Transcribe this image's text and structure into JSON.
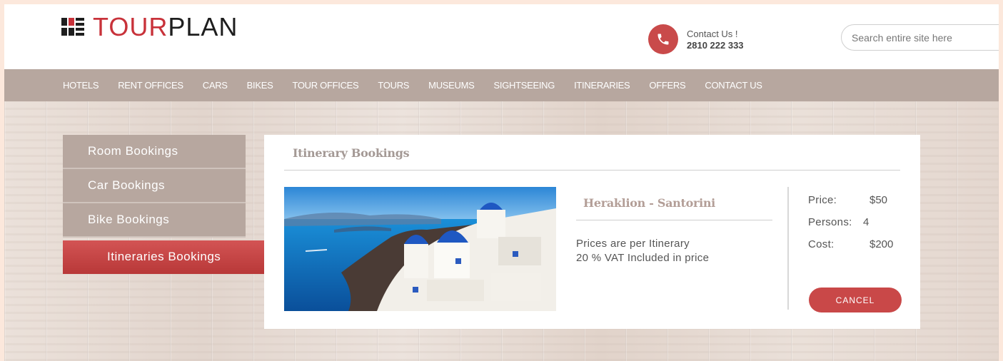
{
  "logo": {
    "part1": "TOUR",
    "part2": "PLAN"
  },
  "contact": {
    "label": "Contact Us !",
    "number": "2810 222 333"
  },
  "search": {
    "placeholder": "Search entire site here"
  },
  "nav": [
    "HOTELS",
    "RENT OFFICES",
    "CARS",
    "BIKES",
    "TOUR OFFICES",
    "TOURS",
    "MUSEUMS",
    "SIGHTSEEING",
    "ITINERARIES",
    "OFFERS",
    "CONTACT US"
  ],
  "side_menu": {
    "items": [
      "Room Bookings",
      "Car Bookings",
      "Bike Bookings"
    ],
    "active": "Itineraries Bookings"
  },
  "booking": {
    "section_title": "Itinerary Bookings",
    "trip_title": "Heraklion - Santorini",
    "note_line1": "Prices are per Itinerary",
    "note_line2": "20 % VAT Included in price",
    "price_label": "Price:",
    "price_value": "$50",
    "persons_label": "Persons:",
    "persons_value": "4",
    "cost_label": "Cost:",
    "cost_value": "$200",
    "cancel_label": "CANCEL"
  },
  "colors": {
    "accent": "#c94848",
    "nav": "#b7a79f",
    "wood": "#e6dad3"
  }
}
